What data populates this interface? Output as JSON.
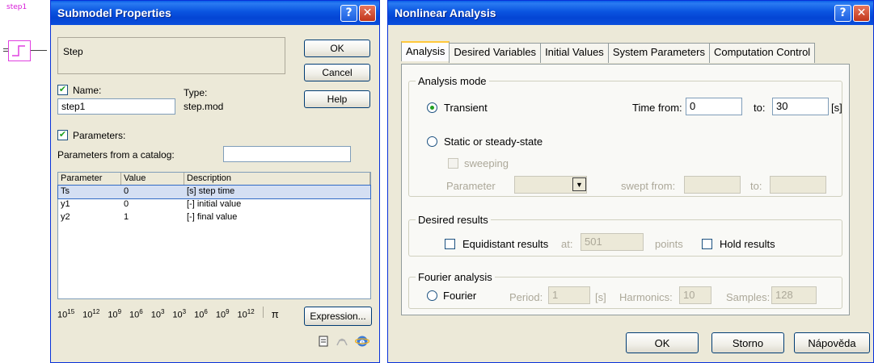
{
  "canvas": {
    "block_label": "step1"
  },
  "submodel": {
    "title": "Submodel Properties",
    "title_buttons": {
      "help": "?",
      "close": "✕"
    },
    "caption": "Step",
    "buttons": {
      "ok": "OK",
      "cancel": "Cancel",
      "help": "Help",
      "expression": "Expression..."
    },
    "name_label": "Name:",
    "name_checked": true,
    "name_value": "step1",
    "type_label": "Type:",
    "type_value": "step.mod",
    "parameters_label": "Parameters:",
    "parameters_checked": true,
    "catalog_label": "Parameters from a catalog:",
    "catalog_value": "",
    "table": {
      "headers": [
        "Parameter",
        "Value",
        "Description"
      ],
      "rows": [
        {
          "param": "Ts",
          "value": "0",
          "desc": "[s] step time"
        },
        {
          "param": "y1",
          "value": "0",
          "desc": "[-] initial value"
        },
        {
          "param": "y2",
          "value": "1",
          "desc": "[-] final value"
        }
      ]
    },
    "powers": [
      {
        "base": "10",
        "exp": "15"
      },
      {
        "base": "10",
        "exp": "12"
      },
      {
        "base": "10",
        "exp": "9"
      },
      {
        "base": "10",
        "exp": "6"
      },
      {
        "base": "10",
        "exp": "3"
      },
      {
        "base": "10",
        "exp": "3"
      },
      {
        "base": "10",
        "exp": "6"
      },
      {
        "base": "10",
        "exp": "9"
      },
      {
        "base": "10",
        "exp": "12"
      }
    ],
    "pi": "π"
  },
  "nonlinear": {
    "title": "Nonlinear Analysis",
    "title_buttons": {
      "help": "?",
      "close": "✕"
    },
    "tabs": [
      "Analysis",
      "Desired Variables",
      "Initial Values",
      "System Parameters",
      "Computation Control"
    ],
    "analysis_mode": {
      "title": "Analysis mode",
      "transient": "Transient",
      "time_from_label": "Time from:",
      "time_from": "0",
      "to_label": "to:",
      "time_to": "30",
      "unit": "[s]",
      "static": "Static or steady-state",
      "sweeping": "sweeping",
      "parameter_label": "Parameter",
      "swept_from_label": "swept from:",
      "swept_to_label": "to:"
    },
    "desired_results": {
      "title": "Desired results",
      "equidistant": "Equidistant results",
      "at_label": "at:",
      "points_value": "501",
      "points_label": "points",
      "hold": "Hold results"
    },
    "fourier": {
      "title": "Fourier analysis",
      "fourier_label": "Fourier",
      "period_label": "Period:",
      "period_value": "1",
      "period_unit": "[s]",
      "harmonics_label": "Harmonics:",
      "harmonics_value": "10",
      "samples_label": "Samples:",
      "samples_value": "128"
    },
    "buttons": {
      "ok": "OK",
      "storno": "Storno",
      "help": "Nápověda"
    }
  }
}
